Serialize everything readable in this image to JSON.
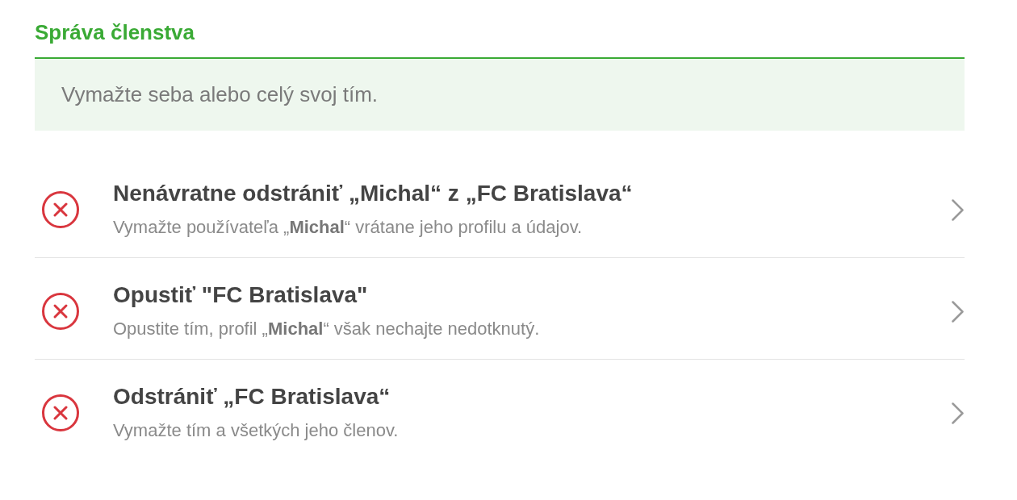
{
  "section": {
    "title": "Správa členstva"
  },
  "banner": {
    "text": "Vymažte seba alebo celý svoj tím."
  },
  "actions": [
    {
      "title": "Nenávratne odstrániť „Michal“ z „FC Bratislava“",
      "description": "Vymažte používateľa „**Michal**“ vrátane jeho profilu a údajov."
    },
    {
      "title": "Opustiť \"FC Bratislava\"",
      "description": "Opustite tím, profil „**Michal**“ však nechajte nedotknutý."
    },
    {
      "title": "Odstrániť „FC Bratislava“",
      "description": "Vymažte tím a všetkých jeho členov."
    }
  ]
}
